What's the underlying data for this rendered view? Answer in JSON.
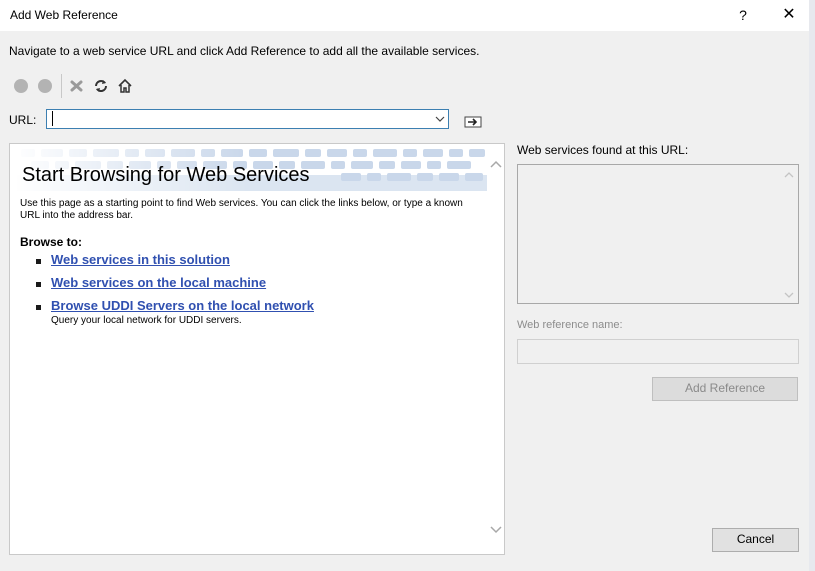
{
  "window": {
    "title": "Add Web Reference",
    "help_glyph": "?",
    "close_glyph": "✕"
  },
  "instruction": "Navigate to a web service URL and click Add Reference to add all the available services.",
  "toolbar": {
    "back_icon": "back-circle-icon",
    "forward_icon": "forward-circle-icon",
    "stop_icon": "stop-x-icon",
    "refresh_icon": "refresh-icon",
    "home_icon": "home-icon"
  },
  "url": {
    "label": "URL:",
    "value": ""
  },
  "browser": {
    "banner_title": "Start Browsing for Web Services",
    "description": "Use this page as a starting point to find Web services. You can click the links below, or type a known URL into the address bar.",
    "browse_heading": "Browse to:",
    "links": [
      {
        "label": "Web services in this solution",
        "description": ""
      },
      {
        "label": "Web services on the local machine",
        "description": ""
      },
      {
        "label": "Browse UDDI Servers on the local network",
        "description": "Query your local network for UDDI servers."
      }
    ]
  },
  "right_panel": {
    "services_label": "Web services found at this URL:",
    "webref_label": "Web reference name:",
    "webref_value": "",
    "add_reference_label": "Add Reference"
  },
  "cancel_label": "Cancel",
  "colors": {
    "link": "#3050b0",
    "accent_border": "#3c7fb1",
    "disabled_text": "#8a8a8a"
  }
}
